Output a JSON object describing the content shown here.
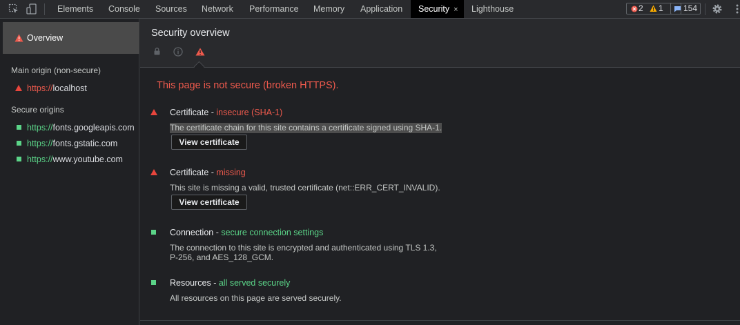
{
  "tabs": [
    {
      "label": "Elements"
    },
    {
      "label": "Console"
    },
    {
      "label": "Sources"
    },
    {
      "label": "Network"
    },
    {
      "label": "Performance"
    },
    {
      "label": "Memory"
    },
    {
      "label": "Application"
    },
    {
      "label": "Security",
      "active": true,
      "close": "×"
    },
    {
      "label": "Lighthouse"
    }
  ],
  "badges": {
    "errors": "2",
    "warnings": "1",
    "messages": "154"
  },
  "sidebar": {
    "overview_label": "Overview",
    "main_origin_heading": "Main origin (non-secure)",
    "main_origin": {
      "scheme": "https://",
      "host": "localhost"
    },
    "secure_origins_heading": "Secure origins",
    "secure_origins": [
      {
        "scheme": "https://",
        "host": "fonts.googleapis.com"
      },
      {
        "scheme": "https://",
        "host": "fonts.gstatic.com"
      },
      {
        "scheme": "https://",
        "host": "www.youtube.com"
      }
    ]
  },
  "main": {
    "title": "Security overview",
    "summary": "This page is not secure (broken HTTPS).",
    "explanations": [
      {
        "title": "Certificate",
        "sep": " - ",
        "status": "insecure (SHA-1)",
        "status_kind": "bad",
        "desc": "The certificate chain for this site contains a certificate signed using SHA-1.",
        "button": "View certificate"
      },
      {
        "title": "Certificate",
        "sep": " - ",
        "status": "missing",
        "status_kind": "bad",
        "desc": "This site is missing a valid, trusted certificate (net::ERR_CERT_INVALID).",
        "button": "View certificate"
      },
      {
        "title": "Connection",
        "sep": " - ",
        "status": "secure connection settings",
        "status_kind": "good",
        "desc_line1": "The connection to this site is encrypted and authenticated using TLS 1.3,",
        "desc_line2": "P-256, and AES_128_GCM."
      },
      {
        "title": "Resources",
        "sep": " - ",
        "status": "all served securely",
        "status_kind": "good",
        "desc": "All resources on this page are served securely."
      }
    ]
  },
  "colors": {
    "insecure": "#ee5a4d",
    "secure": "#5bd488",
    "active_tab_bg": "#000000"
  }
}
